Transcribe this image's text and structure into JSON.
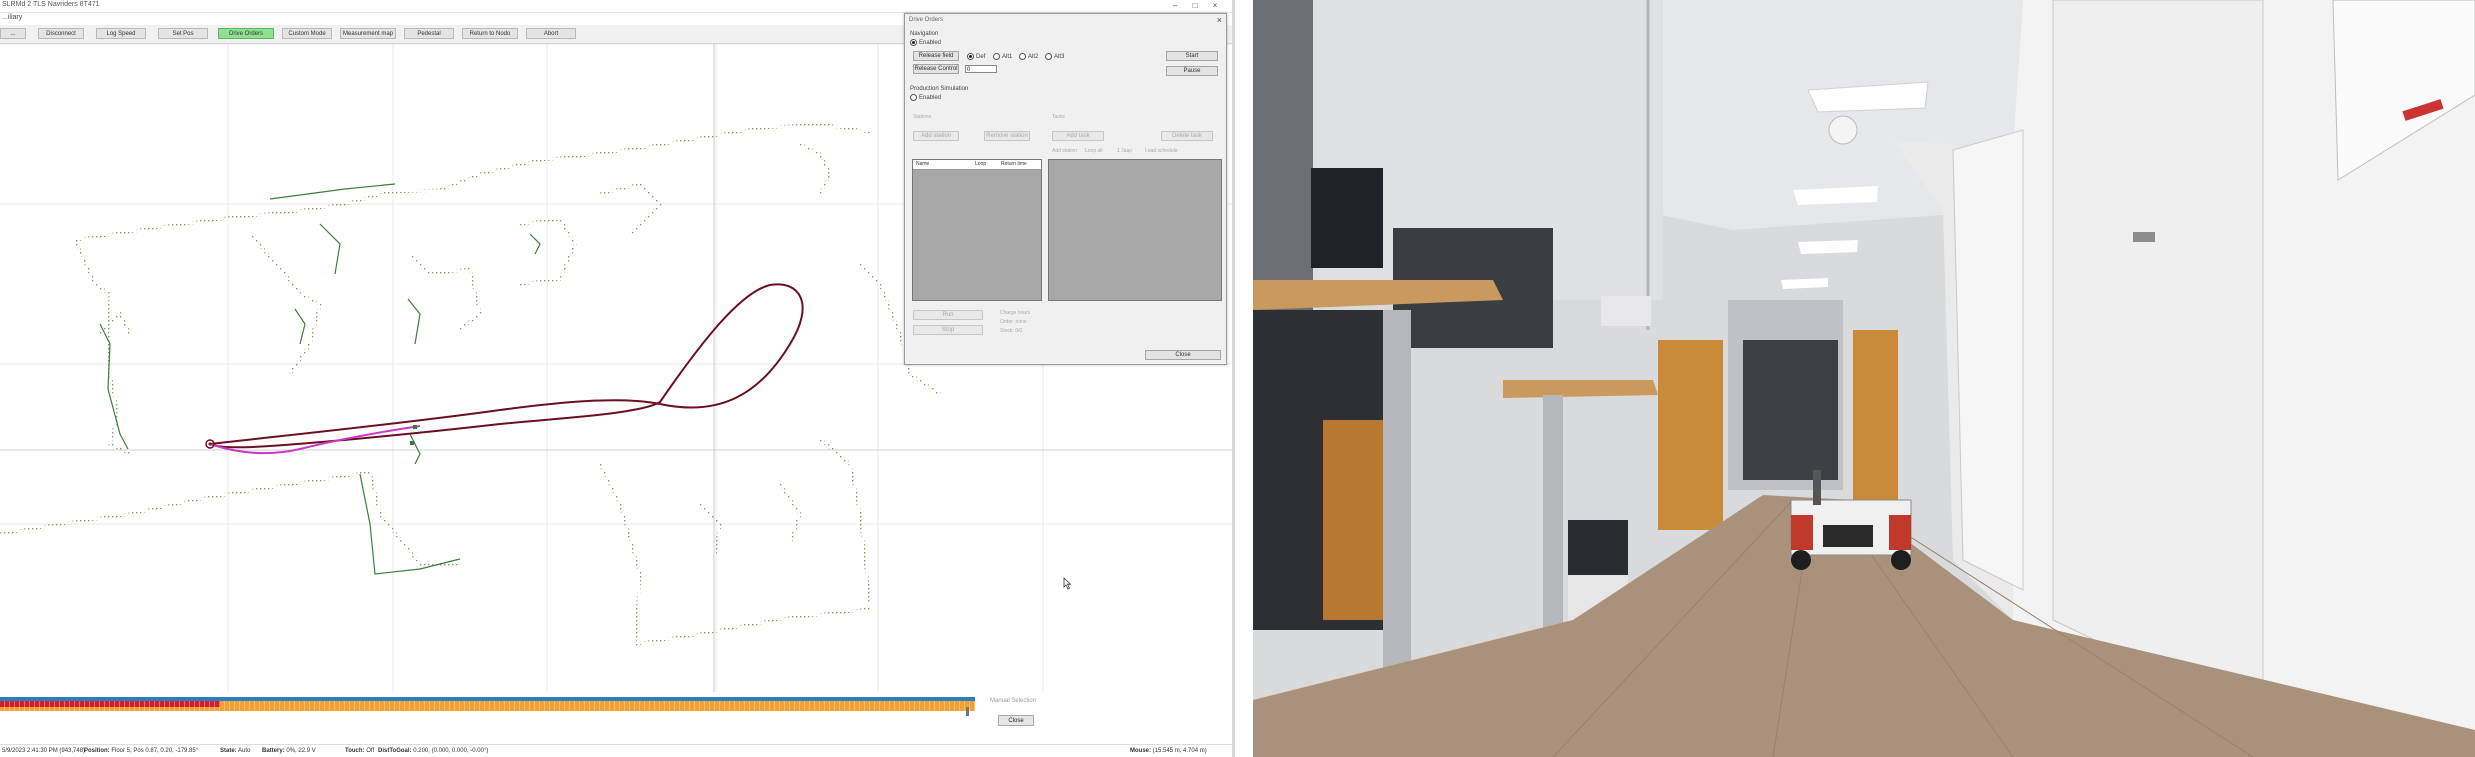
{
  "window": {
    "title": "SLRMd 2 TLS Navriders 8T471",
    "menu_label": "...iliary",
    "controls": [
      "–",
      "□",
      "×"
    ]
  },
  "toolbar": {
    "buttons": [
      {
        "label": "...",
        "active": false
      },
      {
        "label": "Disconnect",
        "active": false
      },
      {
        "label": "Log Speed",
        "active": false
      },
      {
        "label": "Set Pos",
        "active": false
      },
      {
        "label": "Drive Orders",
        "active": true
      },
      {
        "label": "Custom Mode",
        "active": false
      },
      {
        "label": "Measurement map",
        "active": false
      },
      {
        "label": "Pedestal",
        "active": false
      },
      {
        "label": "Return to Nodo",
        "active": false
      },
      {
        "label": "Abort",
        "active": false
      }
    ]
  },
  "dialog": {
    "title": "Drive Orders",
    "close_x": "×",
    "navigation_heading": "Navigation",
    "navigation_enabled": "Enabled",
    "release_field_button": "Release field",
    "release_control_button": "Release Control",
    "release_control_value": "0",
    "radio_options": [
      "Def",
      "Alt1",
      "Alt2",
      "Alt3"
    ],
    "radio_selected": "Def",
    "start_button": "Start",
    "pause_button": "Pause",
    "production_heading": "Production Simulation",
    "production_enabled": "Enabled",
    "station_label": "Stations",
    "tasks_label": "Tasks",
    "add_station_button": "Add station",
    "remove_station_button": "Remove station",
    "add_task_button": "Add task",
    "remove_task_button": "Delete task",
    "options_line": [
      "Add station",
      "Loop all",
      "1 Jaap",
      "Load schedule"
    ],
    "list_headers": [
      "Name",
      "Loop",
      "Return time"
    ],
    "run_button": "Run",
    "stop_button": "Stop",
    "sim_info": [
      "Charge hours",
      "Order: none",
      "Stock: 0/0"
    ],
    "close_button": "Close"
  },
  "replay": {
    "label": "Manual Selection",
    "close_button": "Close"
  },
  "statusbar": {
    "time": "5/9/2023 2:41:30 PM (943,748)",
    "position_label": "Position:",
    "position_value": "Floor 5, Pos 0.87, 0.20, -179.85°",
    "state_label": "State:",
    "state_value": "Auto",
    "battery_label": "Battery:",
    "battery_value": "0%, 22.9 V",
    "touch_label": "Touch:",
    "touch_value": "Off",
    "distance_label": "DistToGoal:",
    "distance_value": "0.200, (0.000, 0.000, -0.00°)",
    "mouse_label": "Mouse:",
    "mouse_value": "(15.545 m, 4.704 m)"
  },
  "colors": {
    "planned_path": "#6b1020",
    "driven_path": "#c93ac9",
    "map_points": "#8a9a5a",
    "map_walls": "#3d7d3d",
    "active_button": "#8fe08f",
    "timeline_orange": "#f7a032",
    "timeline_blue": "#2a7fc0",
    "timeline_red": "#d0202c"
  },
  "photo": {
    "description_icon": "office-corridor-robot-photo"
  }
}
